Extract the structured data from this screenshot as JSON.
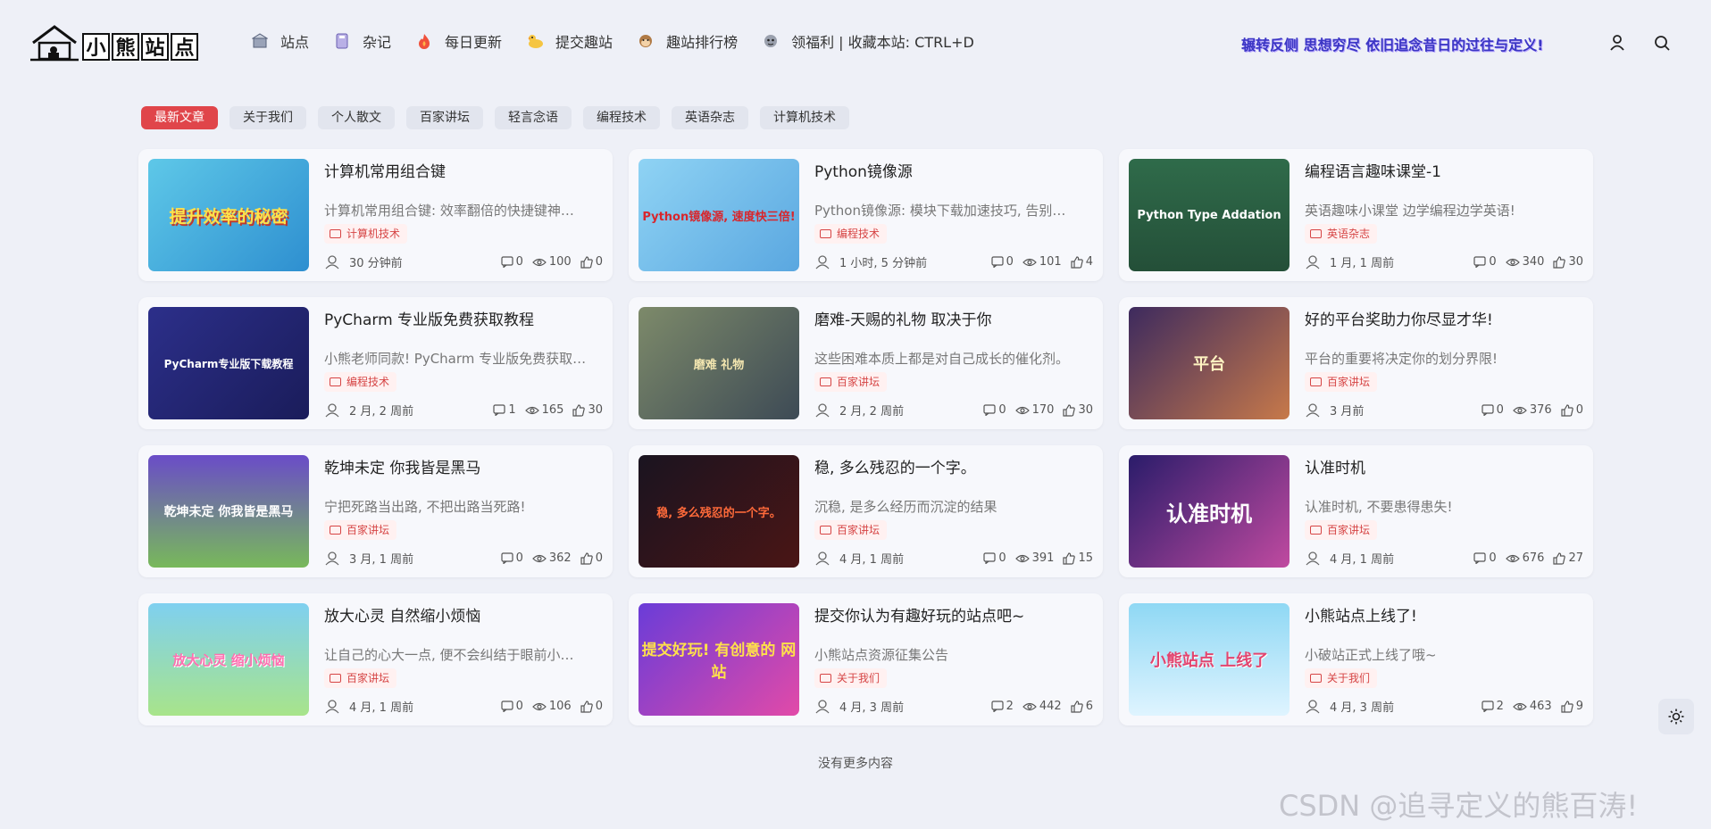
{
  "logo": {
    "chars": [
      "小",
      "熊",
      "站",
      "点"
    ]
  },
  "nav": [
    {
      "label": "站点",
      "icon": "bank-icon"
    },
    {
      "label": "杂记",
      "icon": "notebook-icon"
    },
    {
      "label": "每日更新",
      "icon": "fire-icon"
    },
    {
      "label": "提交趣站",
      "icon": "duck-icon"
    },
    {
      "label": "趣站排行榜",
      "icon": "monkey-icon"
    },
    {
      "label": "领福利 | 收藏本站: CTRL+D",
      "icon": "gift-icon"
    }
  ],
  "slogan": "辗转反侧 思想穷尽 依旧追念昔日的过往与定义!",
  "tabs": [
    "最新文章",
    "关于我们",
    "个人散文",
    "百家讲坛",
    "轻言念语",
    "编程技术",
    "英语杂志",
    "计算机技术"
  ],
  "cards": [
    {
      "title": "计算机常用组合键",
      "excerpt": "计算机常用组合键: 效率翻倍的快捷键神…",
      "tag": "计算机技术",
      "time": "30 分钟前",
      "comments": "0",
      "views": "100",
      "likes": "0",
      "thumb_text": "提升效率的秘密"
    },
    {
      "title": "Python镜像源",
      "excerpt": "Python镜像源: 模块下载加速技巧, 告别…",
      "tag": "编程技术",
      "time": "1 小时, 5 分钟前",
      "comments": "0",
      "views": "101",
      "likes": "4",
      "thumb_text": "Python镜像源, 速度快三倍!"
    },
    {
      "title": "编程语言趣味课堂-1",
      "excerpt": "英语趣味小课堂 边学编程边学英语!",
      "tag": "英语杂志",
      "time": "1 月, 1 周前",
      "comments": "0",
      "views": "340",
      "likes": "30",
      "thumb_text": "Python Type Addation"
    },
    {
      "title": "PyCharm 专业版免费获取教程",
      "excerpt": "小熊老师同款! PyCharm 专业版免费获取…",
      "tag": "编程技术",
      "time": "2 月, 2 周前",
      "comments": "1",
      "views": "165",
      "likes": "30",
      "thumb_text": "PyCharm专业版下载教程"
    },
    {
      "title": "磨难-天赐的礼物 取决于你",
      "excerpt": "这些困难本质上都是对自己成长的催化剂。",
      "tag": "百家讲坛",
      "time": "2 月, 2 周前",
      "comments": "0",
      "views": "170",
      "likes": "30",
      "thumb_text": "磨难 礼物"
    },
    {
      "title": "好的平台奖助力你尽显才华!",
      "excerpt": "平台的重要将决定你的划分界限!",
      "tag": "百家讲坛",
      "time": "3 月前",
      "comments": "0",
      "views": "376",
      "likes": "0",
      "thumb_text": "平台"
    },
    {
      "title": "乾坤未定 你我皆是黑马",
      "excerpt": "宁把死路当出路, 不把出路当死路!",
      "tag": "百家讲坛",
      "time": "3 月, 1 周前",
      "comments": "0",
      "views": "362",
      "likes": "0",
      "thumb_text": "乾坤未定 你我皆是黑马"
    },
    {
      "title": "稳, 多么残忍的一个字。",
      "excerpt": "沉稳, 是多么经历而沉淀的结果",
      "tag": "百家讲坛",
      "time": "4 月, 1 周前",
      "comments": "0",
      "views": "391",
      "likes": "15",
      "thumb_text": "稳, 多么残忍的一个字。"
    },
    {
      "title": "认准时机",
      "excerpt": "认准时机, 不要患得患失!",
      "tag": "百家讲坛",
      "time": "4 月, 1 周前",
      "comments": "0",
      "views": "676",
      "likes": "27",
      "thumb_text": "认准时机"
    },
    {
      "title": "放大心灵 自然缩小烦恼",
      "excerpt": "让自己的心大一点, 便不会纠结于眼前小…",
      "tag": "百家讲坛",
      "time": "4 月, 1 周前",
      "comments": "0",
      "views": "106",
      "likes": "0",
      "thumb_text": "放大心灵 缩小烦恼"
    },
    {
      "title": "提交你认为有趣好玩的站点吧~",
      "excerpt": "小熊站点资源征集公告",
      "tag": "关于我们",
      "time": "4 月, 3 周前",
      "comments": "2",
      "views": "442",
      "likes": "6",
      "thumb_text": "提交好玩! 有创意的 网站"
    },
    {
      "title": "小熊站点上线了!",
      "excerpt": "小破站正式上线了哦~",
      "tag": "关于我们",
      "time": "4 月, 3 周前",
      "comments": "2",
      "views": "463",
      "likes": "9",
      "thumb_text": "小熊站点 上线了"
    }
  ],
  "no_more": "没有更多内容",
  "watermark": "CSDN @追寻定义的熊百涛!"
}
